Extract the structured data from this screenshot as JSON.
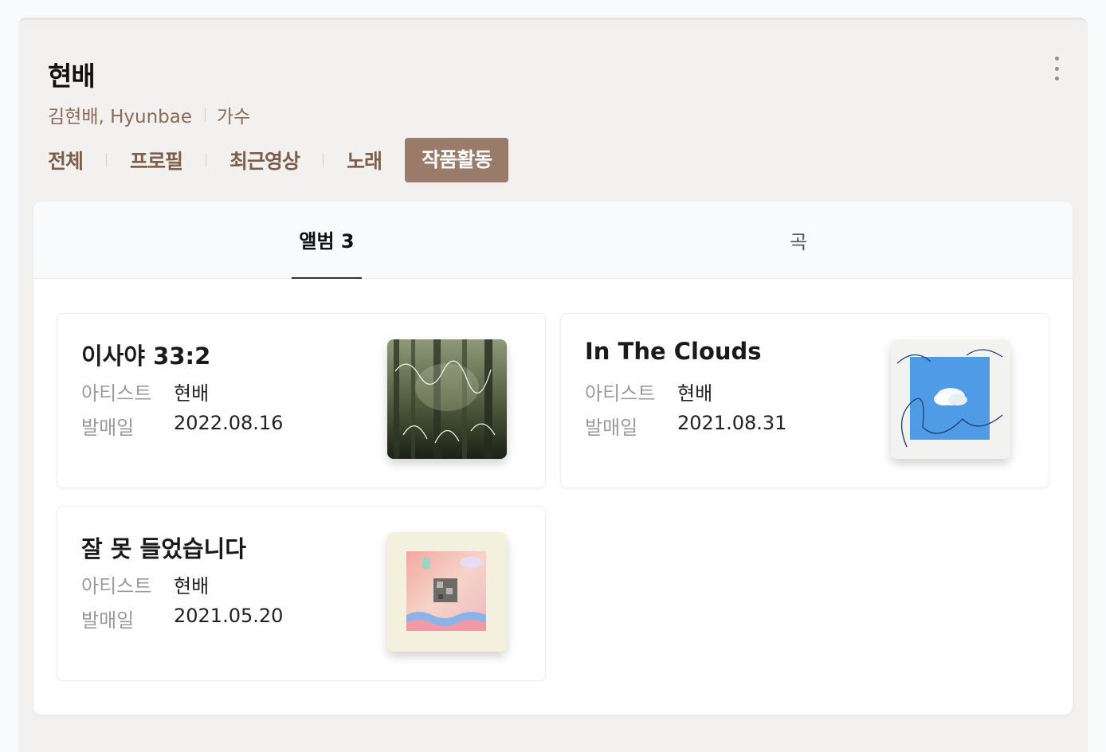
{
  "artist": {
    "name": "현배",
    "aliases": "김현배, Hyunbae",
    "role": "가수"
  },
  "tabs": [
    {
      "label": "전체"
    },
    {
      "label": "프로필"
    },
    {
      "label": "최근영상"
    },
    {
      "label": "노래"
    },
    {
      "label": "작품활동",
      "active": true
    }
  ],
  "subtabs": {
    "albums_label": "앨범 3",
    "songs_label": "곡"
  },
  "fields": {
    "artist_label": "아티스트",
    "release_label": "발매일"
  },
  "albums": [
    {
      "title": "이사야 33:2",
      "artist": "현배",
      "release_date": "2022.08.16",
      "cover_icon": "forest-cover"
    },
    {
      "title": "In The Clouds",
      "artist": "현배",
      "release_date": "2021.08.31",
      "cover_icon": "cloud-cover"
    },
    {
      "title": "잘 못 들었습니다",
      "artist": "현배",
      "release_date": "2021.05.20",
      "cover_icon": "pastel-cover"
    }
  ],
  "colors": {
    "accent": "#9a7a68",
    "tab_text": "#7d5e4b",
    "panel_bg": "#f3f1ef"
  }
}
